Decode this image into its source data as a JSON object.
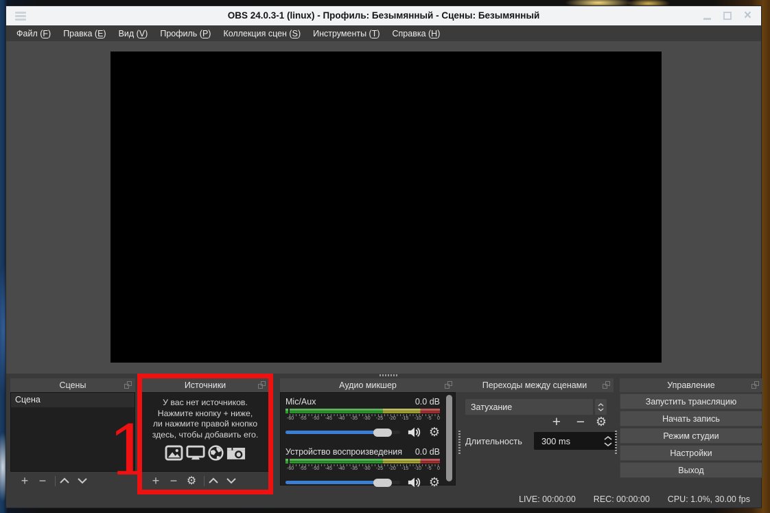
{
  "window": {
    "title": "OBS 24.0.3-1 (linux) - Профиль: Безымянный - Сцены: Безымянный",
    "icons": {
      "close": "×"
    }
  },
  "icons": {
    "plus": "+",
    "minus": "−",
    "gear": "⚙"
  },
  "menubar": {
    "items": [
      {
        "before": "Файл (",
        "key": "F",
        "after": ")"
      },
      {
        "before": "Правка (",
        "key": "E",
        "after": ")"
      },
      {
        "before": "Вид (",
        "key": "V",
        "after": ")"
      },
      {
        "before": "Профиль (",
        "key": "P",
        "after": ")"
      },
      {
        "before": "Коллекция сцен (",
        "key": "S",
        "after": ")"
      },
      {
        "before": "Инструменты (",
        "key": "T",
        "after": ")"
      },
      {
        "before": "Справка (",
        "key": "H",
        "after": ")"
      }
    ]
  },
  "panels": {
    "scenes": {
      "title": "Сцены",
      "items": [
        "Сцена"
      ]
    },
    "sources": {
      "title": "Источники",
      "empty_lines": [
        "У вас нет источников.",
        "Нажмите кнопку + ниже,",
        "ли нажмите правой кнопко",
        "здесь, чтобы добавить его."
      ],
      "icon_names": [
        "image-icon",
        "display-icon",
        "globe-icon",
        "camera-icon"
      ]
    },
    "mixer": {
      "title": "Аудио микшер",
      "channels": [
        {
          "name": "Mic/Aux",
          "level": "0.0 dB"
        },
        {
          "name": "Устройство воспроизведения",
          "level": "0.0 dB"
        }
      ],
      "ticks": [
        "-60",
        "-55",
        "-50",
        "-45",
        "-40",
        "-35",
        "-30",
        "-25",
        "-20",
        "-15",
        "-10",
        "-5",
        "0"
      ]
    },
    "transitions": {
      "title": "Переходы между сценами",
      "selected": "Затухание",
      "duration_label": "Длительность",
      "duration_value": "300 ms"
    },
    "controls": {
      "title": "Управление",
      "buttons": [
        "Запустить трансляцию",
        "Начать запись",
        "Режим студии",
        "Настройки",
        "Выход"
      ]
    }
  },
  "statusbar": {
    "live": "LIVE: 00:00:00",
    "rec": "REC: 00:00:00",
    "cpu": "CPU: 1.0%, 30.00 fps"
  },
  "annotation": {
    "label": "1",
    "color": "#ee1111"
  },
  "colors": {
    "accent_red": "#ee1111",
    "slider_blue": "#3b7fd4",
    "meter_green": "#2f9e2f",
    "meter_yellow": "#a8a832",
    "meter_red": "#a83232",
    "titlebar_bg": "#f2f3f4",
    "menubar_bg": "#3b3b3b"
  }
}
